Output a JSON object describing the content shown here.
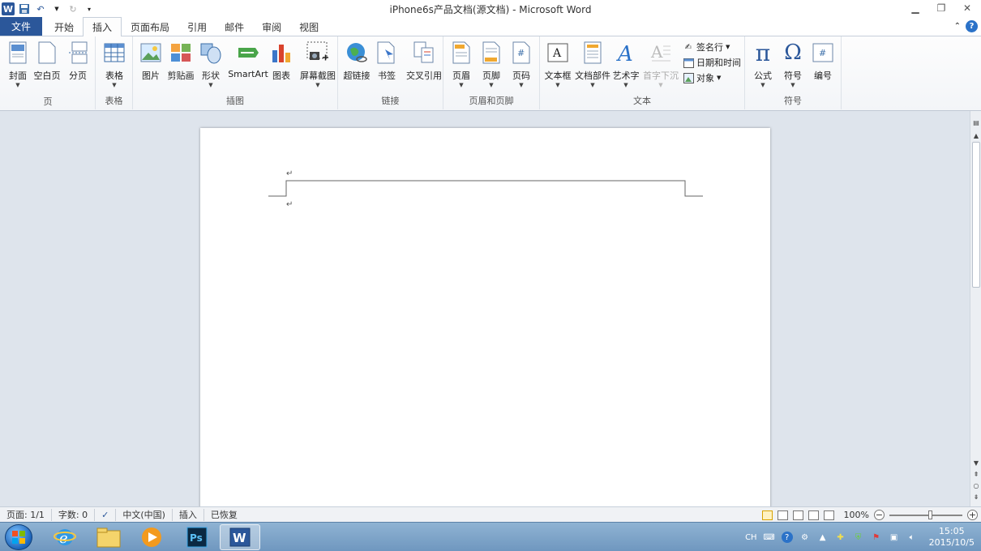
{
  "window": {
    "title": "iPhone6s产品文档(源文档) - Microsoft Word"
  },
  "tabs": [
    {
      "label": "文件"
    },
    {
      "label": "开始"
    },
    {
      "label": "插入"
    },
    {
      "label": "页面布局"
    },
    {
      "label": "引用"
    },
    {
      "label": "邮件"
    },
    {
      "label": "审阅"
    },
    {
      "label": "视图"
    }
  ],
  "ribbon": {
    "groups": {
      "page": "页",
      "table": "表格",
      "illustrations": "插图",
      "links": "链接",
      "header_footer": "页眉和页脚",
      "text": "文本",
      "symbols": "符号"
    },
    "buttons": {
      "cover": "封面",
      "blank": "空白页",
      "break": "分页",
      "table": "表格",
      "picture": "图片",
      "clipart": "剪贴画",
      "shapes": "形状",
      "smartart": "SmartArt",
      "chart": "图表",
      "screenshot": "屏幕截图",
      "hyperlink": "超链接",
      "bookmark": "书签",
      "crossref": "交叉引用",
      "header": "页眉",
      "footer": "页脚",
      "pagenum": "页码",
      "textbox": "文本框",
      "quickparts": "文档部件",
      "wordart": "艺术字",
      "dropcap": "首字下沉",
      "signature": "签名行",
      "datetime": "日期和时间",
      "object": "对象",
      "equation": "公式",
      "symbol": "符号",
      "number": "编号"
    }
  },
  "document": {
    "para_mark": "↵"
  },
  "status": {
    "page": "页面: 1/1",
    "words": "字数: 0",
    "language": "中文(中国)",
    "mode": "插入",
    "recovered": "已恢复",
    "zoom": "100%"
  },
  "taskbar": {
    "lang": "CH",
    "time": "15:05",
    "date": "2015/10/5"
  }
}
